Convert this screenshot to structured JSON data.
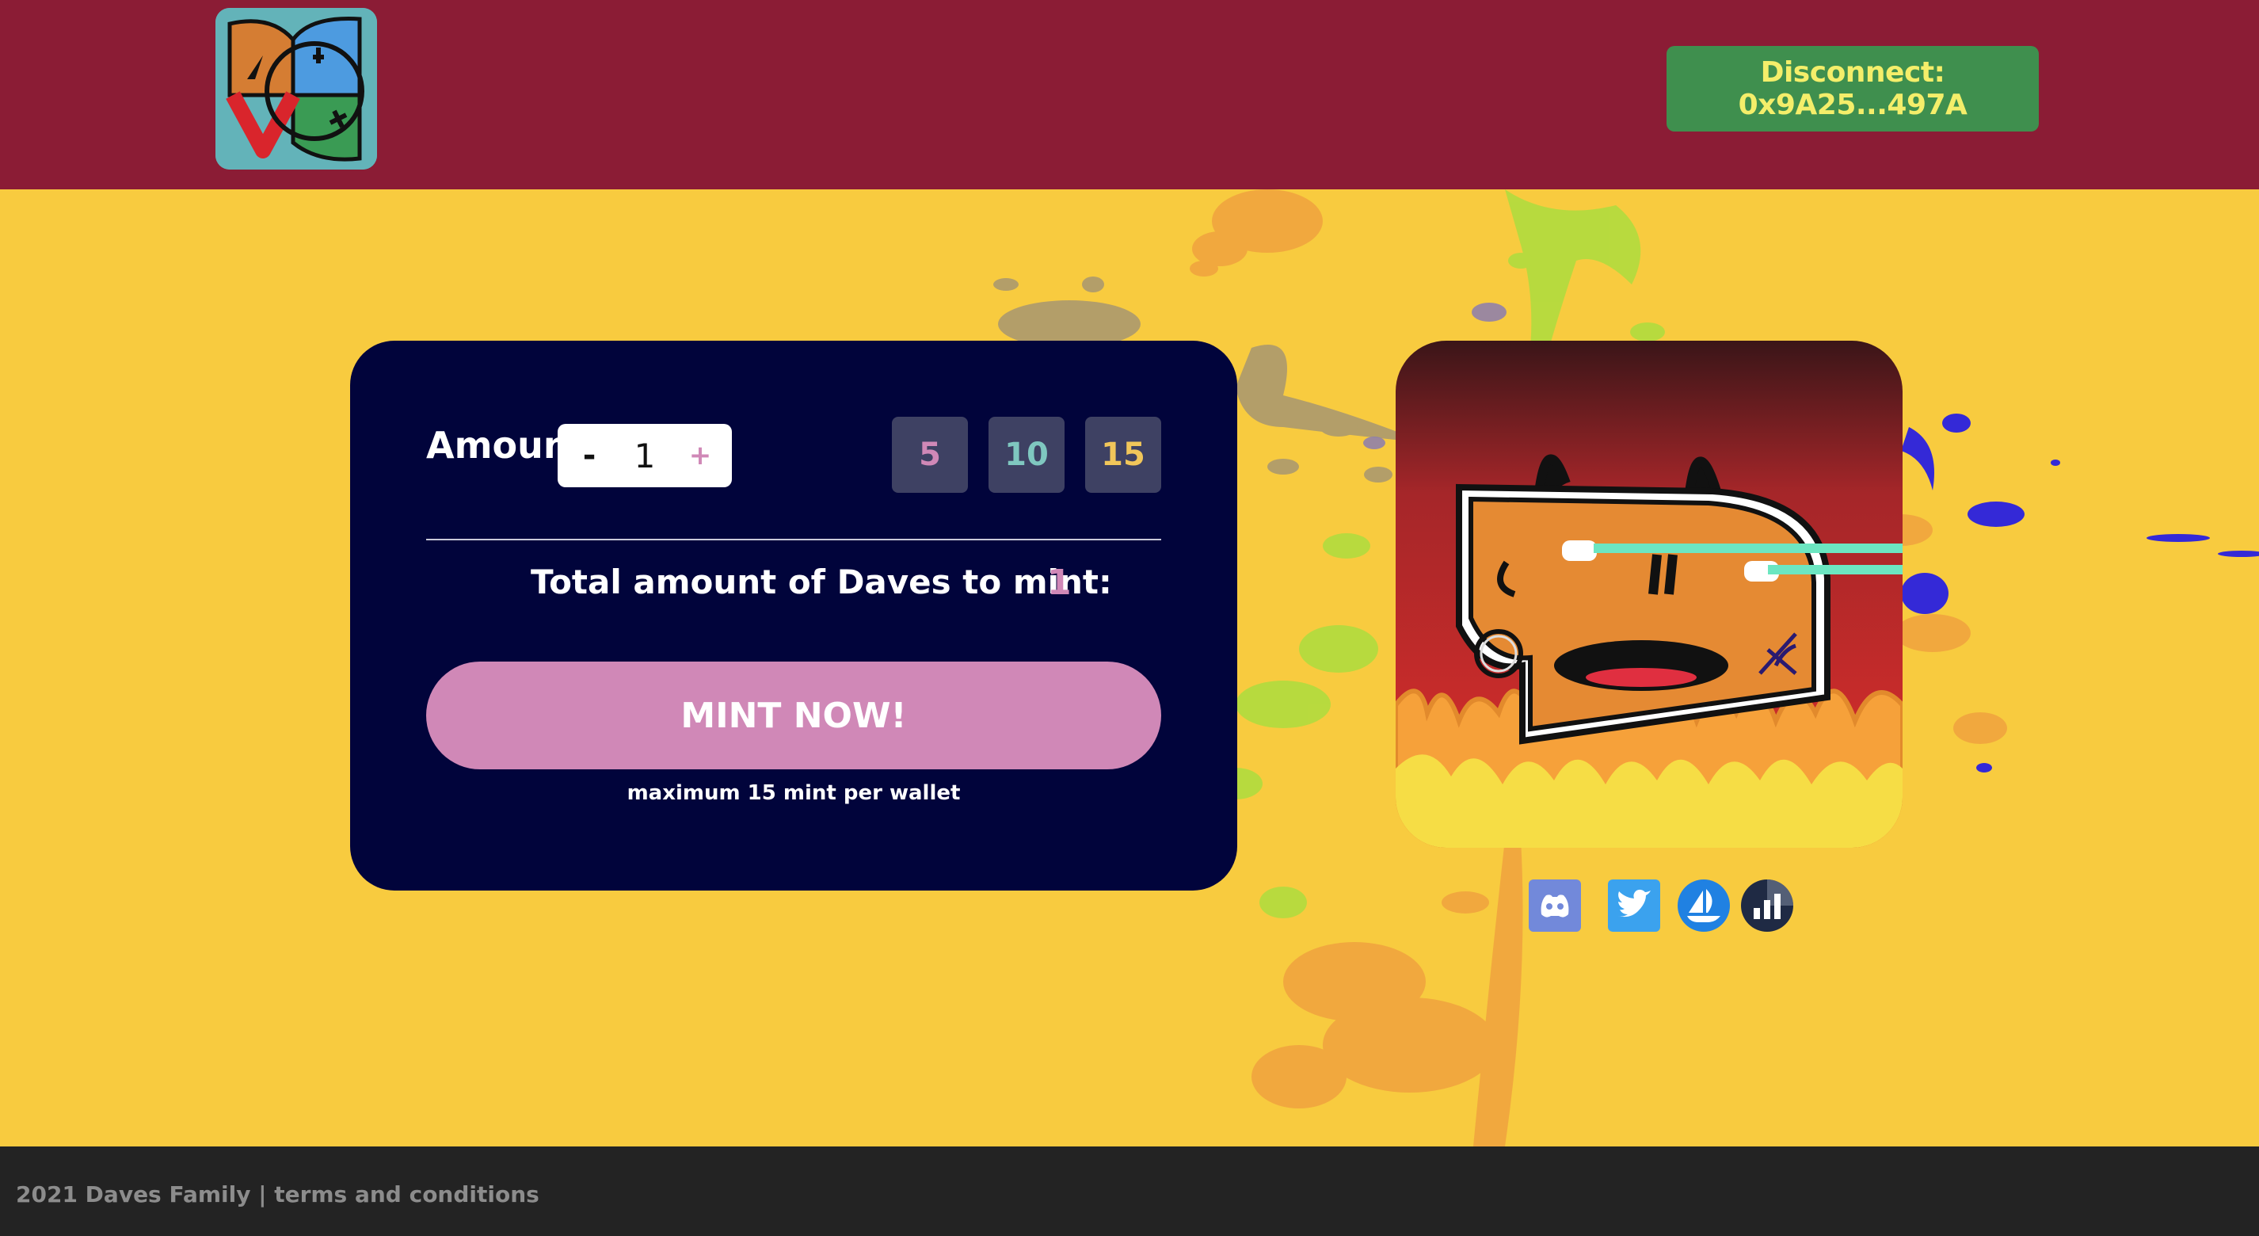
{
  "header": {
    "logo_icon": "daves-family-logo",
    "disconnect_label": "Disconnect: 0x9A25...497A"
  },
  "mint": {
    "amount_label": "Amount",
    "stepper": {
      "minus": "-",
      "value": "1",
      "plus": "+"
    },
    "quick_amounts": [
      {
        "label": "5",
        "color": "#d088b7"
      },
      {
        "label": "10",
        "color": "#7fc7c0"
      },
      {
        "label": "15",
        "color": "#f1c65a"
      }
    ],
    "total_label": "Total amount of Daves to mint:",
    "total_value": "1",
    "mint_button": "MINT NOW!",
    "max_note": "maximum 15 mint per wallet"
  },
  "socials": [
    {
      "icon": "discord-icon"
    },
    {
      "icon": "twitter-icon"
    },
    {
      "icon": "opensea-icon"
    },
    {
      "icon": "stats-icon"
    }
  ],
  "footer": {
    "text": "2021 Daves Family | terms and conditions"
  },
  "colors": {
    "header_bg": "#8b1c35",
    "page_bg": "#f8cb3f",
    "panel_bg": "#01043b",
    "accent_pink": "#d088b7",
    "disconnect_bg": "#3f8f4e",
    "disconnect_text": "#f4ee6a",
    "footer_bg": "#232323"
  }
}
